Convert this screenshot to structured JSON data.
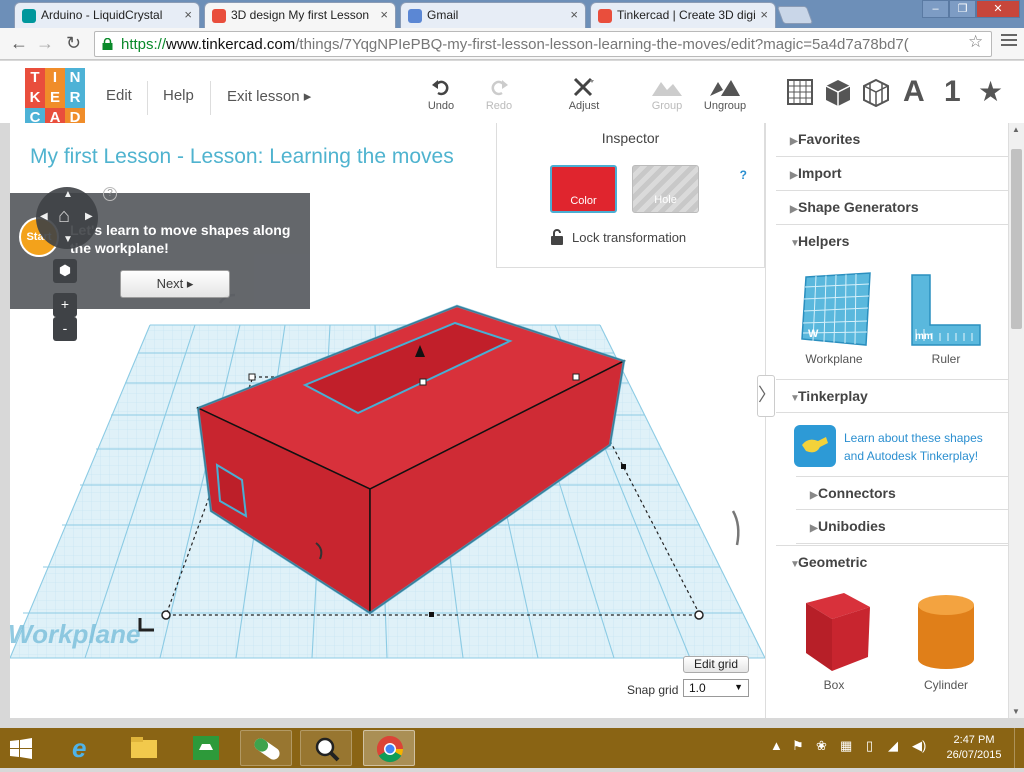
{
  "browser": {
    "tabs": [
      {
        "title": "Arduino - LiquidCrystal",
        "active": false
      },
      {
        "title": "3D design My first Lesson",
        "active": true
      },
      {
        "title": "Gmail",
        "active": false
      },
      {
        "title": "Tinkercad | Create 3D digi",
        "active": false
      }
    ],
    "url_protocol": "https://",
    "url_host": "www.tinkercad.com",
    "url_path": "/things/7YqgNPIePBQ-my-first-lesson-lesson-learning-the-moves/edit?magic=5a4d7a78bd7("
  },
  "header": {
    "logo_letters": [
      "T",
      "I",
      "N",
      "K",
      "E",
      "R",
      "C",
      "A",
      "D"
    ],
    "menu": {
      "edit": "Edit",
      "help": "Help",
      "exit_lesson": "Exit lesson ▸"
    },
    "tools": {
      "undo": "Undo",
      "redo": "Redo",
      "adjust": "Adjust",
      "group": "Group",
      "ungroup": "Ungroup"
    },
    "library_icons": {
      "text_a": "A",
      "number_1": "1",
      "star": "★"
    }
  },
  "workspace": {
    "lesson_title": "My first Lesson - Lesson: Learning the moves",
    "lesson_instruction_line1": "Let's learn to move shapes along",
    "lesson_instruction_line2": "the workplane!",
    "next_label": "Next ▸",
    "start_label": "Start",
    "help_mark": "?",
    "zoom_in": "+",
    "zoom_out": "-",
    "workplane_label": "Workplane",
    "edit_grid_label": "Edit grid",
    "snap_grid_label": "Snap grid",
    "snap_grid_value": "1.0",
    "colors": {
      "shape": "#d8313b",
      "grid": "#9ed3ea",
      "accent": "#4fb3cf"
    }
  },
  "inspector": {
    "title": "Inspector",
    "color_label": "Color",
    "hole_label": "Hole",
    "help_mark": "?",
    "lock_label": "Lock transformation"
  },
  "library": {
    "favorites": "Favorites",
    "import": "Import",
    "shape_generators": "Shape Generators",
    "helpers": "Helpers",
    "helper_items": [
      "Workplane",
      "Ruler"
    ],
    "tinkerplay": "Tinkerplay",
    "tinkerplay_text_line1": "Learn about these shapes",
    "tinkerplay_text_line2": "and Autodesk Tinkerplay!",
    "connectors": "Connectors",
    "unibodies": "Unibodies",
    "geometric": "Geometric",
    "geometric_items": [
      "Box",
      "Cylinder"
    ],
    "collapse_icon": "〉"
  },
  "taskbar": {
    "clock_time": "2:47 PM",
    "clock_date": "26/07/2015"
  }
}
